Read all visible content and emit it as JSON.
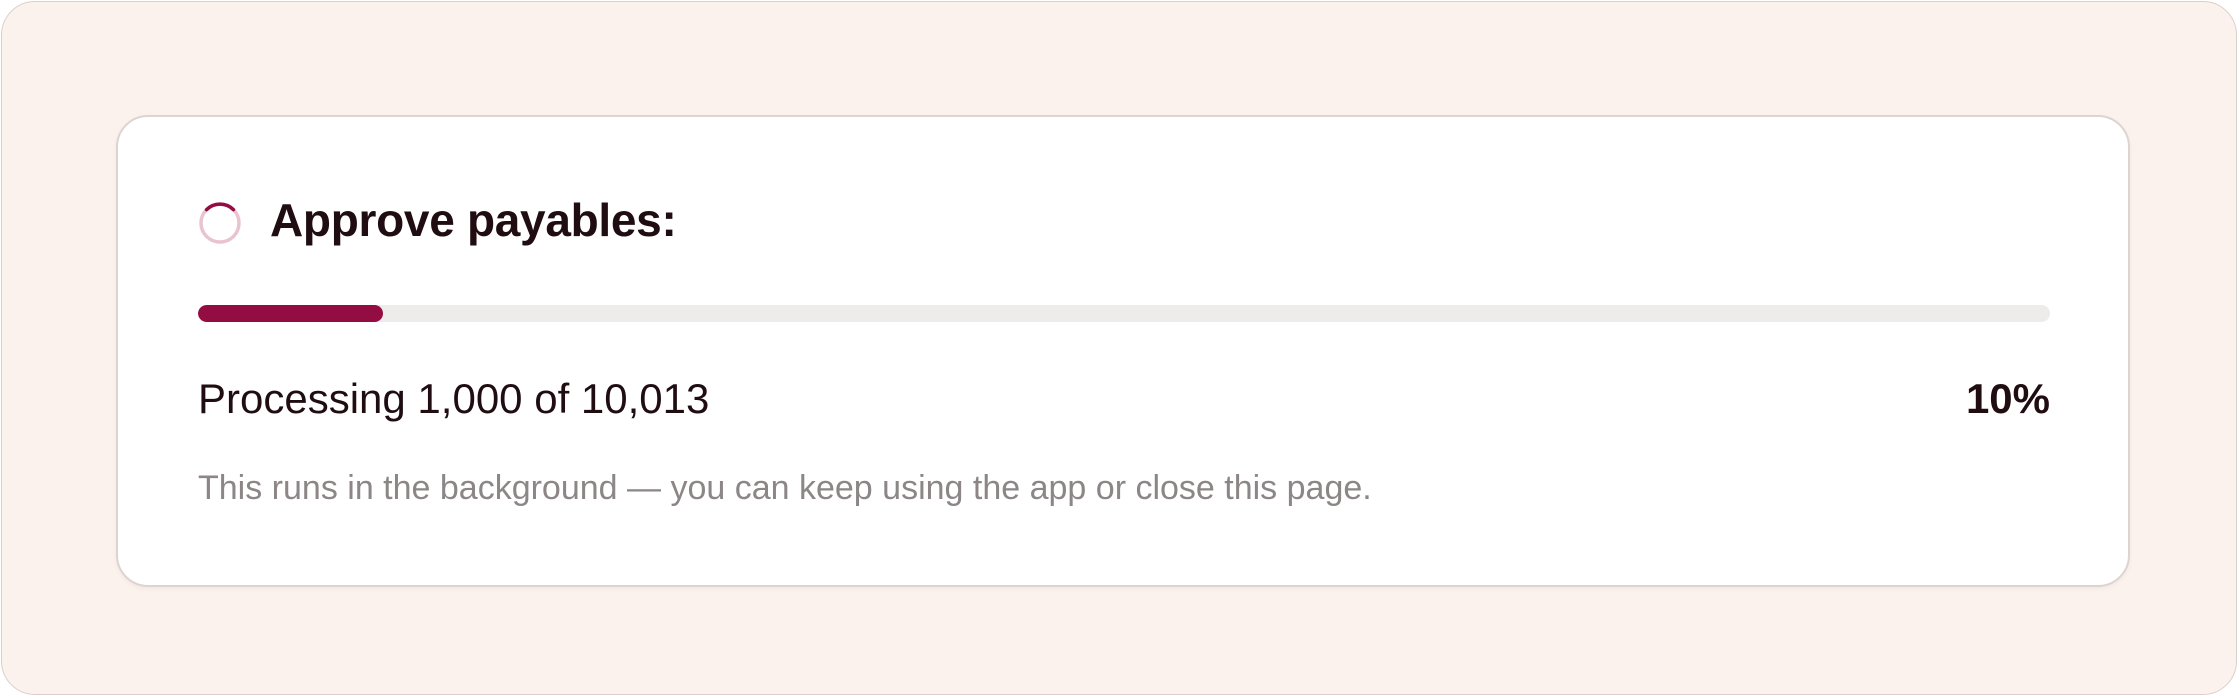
{
  "task": {
    "title": "Approve payables:",
    "spinner_icon": "loading-spinner-icon",
    "status_text": "Processing 1,000 of 10,013",
    "percent_text": "10%",
    "progress_fraction": 0.1,
    "note": "This runs in the background — you can keep using the app or close this page."
  },
  "colors": {
    "page_background": "#fbf2ed",
    "card_background": "#ffffff",
    "accent": "#930d43",
    "spinner_track": "#e9c4cf",
    "progress_track": "#eeebeb",
    "text_primary": "#1f0d12",
    "text_muted": "#8c8686"
  }
}
